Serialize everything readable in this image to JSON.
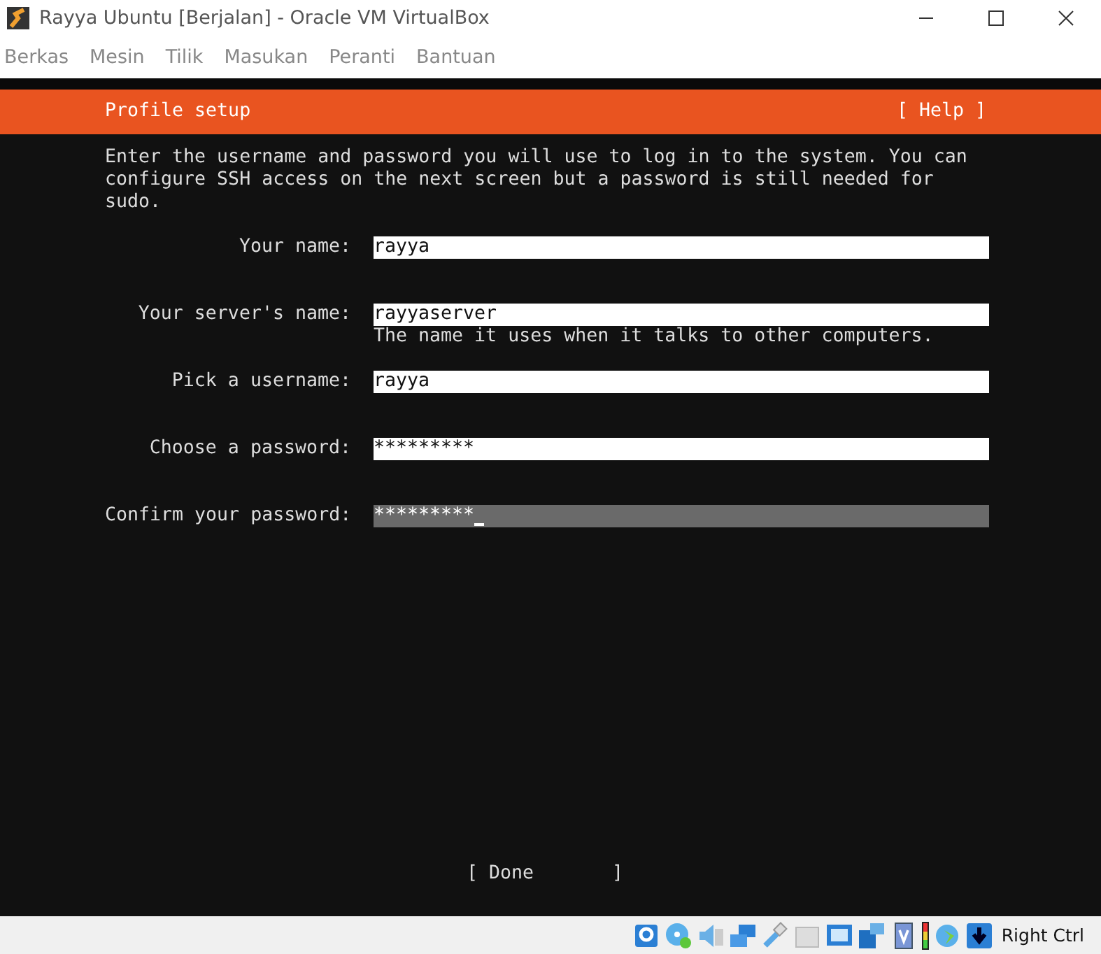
{
  "window": {
    "title": "Rayya Ubuntu [Berjalan] - Oracle VM VirtualBox"
  },
  "menu": [
    "Berkas",
    "Mesin",
    "Tilik",
    "Masukan",
    "Peranti",
    "Bantuan"
  ],
  "header": {
    "title": "Profile setup",
    "help": "[ Help ]"
  },
  "intro": "Enter the username and password you will use to log in to the system. You can configure SSH access on the next screen but a password is still needed for sudo.",
  "fields": [
    {
      "label": "Your name:",
      "value": "rayya",
      "focused": false
    },
    {
      "label": "Your server's name:",
      "value": "rayyaserver",
      "hint": "The name it uses when it talks to other computers.",
      "focused": false
    },
    {
      "label": "Pick a username:",
      "value": "rayya",
      "focused": false
    },
    {
      "label": "Choose a password:",
      "value": "*********",
      "focused": false
    },
    {
      "label": "Confirm your password:",
      "value": "*********",
      "focused": true
    }
  ],
  "done": "[ Done       ]",
  "status_bar": {
    "host_key": "Right Ctrl"
  }
}
